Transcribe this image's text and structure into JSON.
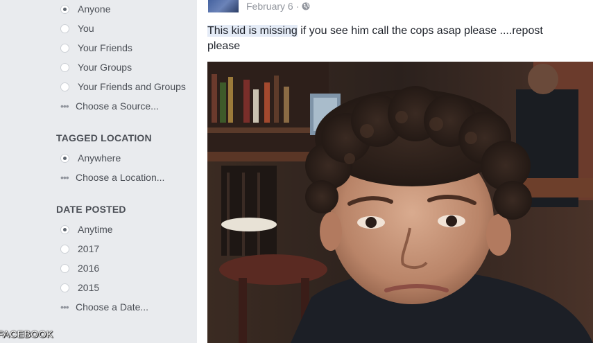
{
  "source_filter": {
    "options": [
      {
        "label": "Anyone",
        "checked": true
      },
      {
        "label": "You",
        "checked": false
      },
      {
        "label": "Your Friends",
        "checked": false
      },
      {
        "label": "Your Groups",
        "checked": false
      },
      {
        "label": "Your Friends and Groups",
        "checked": false
      }
    ],
    "choose_label": "Choose a Source..."
  },
  "tagged_location": {
    "title": "TAGGED LOCATION",
    "options": [
      {
        "label": "Anywhere",
        "checked": true
      }
    ],
    "choose_label": "Choose a Location..."
  },
  "date_posted": {
    "title": "DATE POSTED",
    "options": [
      {
        "label": "Anytime",
        "checked": true
      },
      {
        "label": "2017",
        "checked": false
      },
      {
        "label": "2016",
        "checked": false
      },
      {
        "label": "2015",
        "checked": false
      }
    ],
    "choose_label": "Choose a Date..."
  },
  "watermark": "FACEBOOK",
  "post": {
    "date": "February 6",
    "separator": "·",
    "privacy_icon": "globe-icon",
    "text_highlight": "This kid is missing",
    "text_rest": " if you see him call the cops asap please ....repost please"
  }
}
